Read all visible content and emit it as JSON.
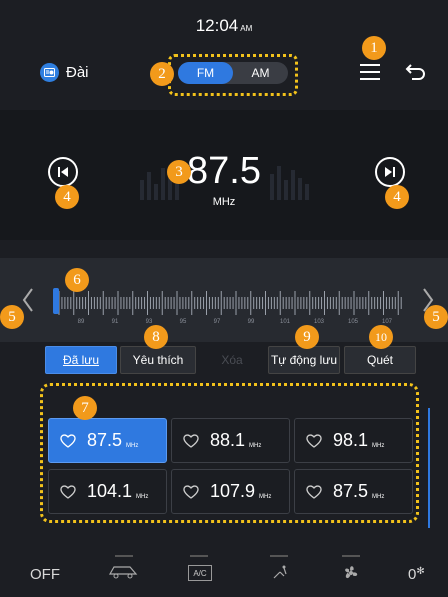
{
  "status": {
    "time": "12:04",
    "ampm": "AM"
  },
  "header": {
    "title": "Đài",
    "icon": "radio-icon"
  },
  "band": {
    "options": [
      "FM",
      "AM"
    ],
    "active": "FM"
  },
  "frequency": {
    "value": "87.5",
    "unit": "MHz"
  },
  "scale": {
    "labels": [
      "89",
      "91",
      "93",
      "95",
      "97",
      "99",
      "101",
      "103",
      "105",
      "107"
    ]
  },
  "tabs": {
    "saved": "Đã lưu",
    "favorite": "Yêu thích",
    "delete": "Xóa",
    "autosave": "Tự động lưu",
    "scan": "Quét"
  },
  "presets": [
    {
      "value": "87.5",
      "unit": "MHz",
      "active": true
    },
    {
      "value": "88.1",
      "unit": "MHz",
      "active": false
    },
    {
      "value": "98.1",
      "unit": "MHz",
      "active": false
    },
    {
      "value": "104.1",
      "unit": "MHz",
      "active": false
    },
    {
      "value": "107.9",
      "unit": "MHz",
      "active": false
    },
    {
      "value": "87.5",
      "unit": "MHz",
      "active": false
    }
  ],
  "badges": [
    "1",
    "2",
    "3",
    "4",
    "4",
    "5",
    "5",
    "6",
    "7",
    "8",
    "9",
    "10"
  ],
  "climate": {
    "off": "OFF",
    "ac": "A/C",
    "fan_level": "0"
  },
  "colors": {
    "accent": "#2f79e0",
    "badge": "#f29a1b",
    "highlight": "#f2c21b"
  }
}
